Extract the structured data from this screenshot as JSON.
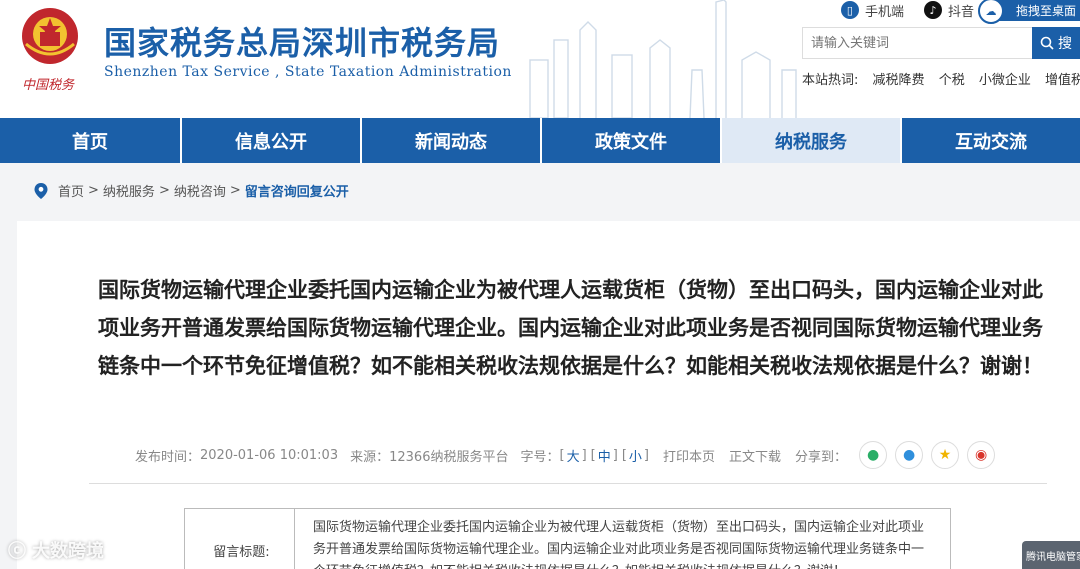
{
  "header": {
    "site_name": "国家税务总局深圳市税务局",
    "site_name_en": "Shenzhen Tax Service , State Taxation Administration",
    "motto": "中国税务",
    "top_links": [
      {
        "label": "手机端",
        "icon": "mobile-icon"
      },
      {
        "label": "抖音",
        "icon": "tiktok-icon"
      },
      {
        "label": "拖拽至桌面",
        "icon": "cloud-icon"
      }
    ],
    "search_placeholder": "请输入关键词",
    "search_button": "搜",
    "hotwords_label": "本站热词:",
    "hotwords": [
      "减税降费",
      "个税",
      "小微企业",
      "增值税"
    ]
  },
  "nav": {
    "items": [
      {
        "label": "首页"
      },
      {
        "label": "信息公开"
      },
      {
        "label": "新闻动态"
      },
      {
        "label": "政策文件"
      },
      {
        "label": "纳税服务"
      },
      {
        "label": "互动交流"
      }
    ],
    "active_index": 4
  },
  "breadcrumb": [
    "首页",
    "纳税服务",
    "纳税咨询",
    "留言咨询回复公开"
  ],
  "article": {
    "title": "国际货物运输代理企业委托国内运输企业为被代理人运载货柜（货物）至出口码头，国内运输企业对此项业务开普通发票给国际货物运输代理企业。国内运输企业对此项业务是否视同国际货物运输代理业务链条中一个环节免征增值税？如不能相关税收法规依据是什么？如能相关税收法规依据是什么？谢谢！",
    "meta": {
      "publish_label": "发布时间：",
      "publish_time": "2020-01-06 10:01:03",
      "source_label": "来源：",
      "source": "12366纳税服务平台",
      "font_label": "字号：",
      "font_large": "大",
      "font_medium": "中",
      "font_small": "小",
      "print": "打印本页",
      "download": "正文下载",
      "share_label": "分享到："
    },
    "table": {
      "label": "留言标题:",
      "value": "国际货物运输代理企业委托国内运输企业为被代理人运载货柜（货物）至出口码头，国内运输企业对此项业务开普通发票给国际货物运输代理企业。国内运输企业对此项业务是否视同国际货物运输代理业务链条中一个环节免征增值税？如不能相关税收法规依据是什么？如能相关税收法规依据是什么？谢谢！"
    }
  },
  "overlay": {
    "watermark": "大数跨境",
    "promo": "腾讯电脑管家"
  },
  "colors": {
    "brand_blue": "#1b5fa8",
    "nav_active_bg": "#dfe9f5",
    "emblem_red": "#c0272d"
  }
}
